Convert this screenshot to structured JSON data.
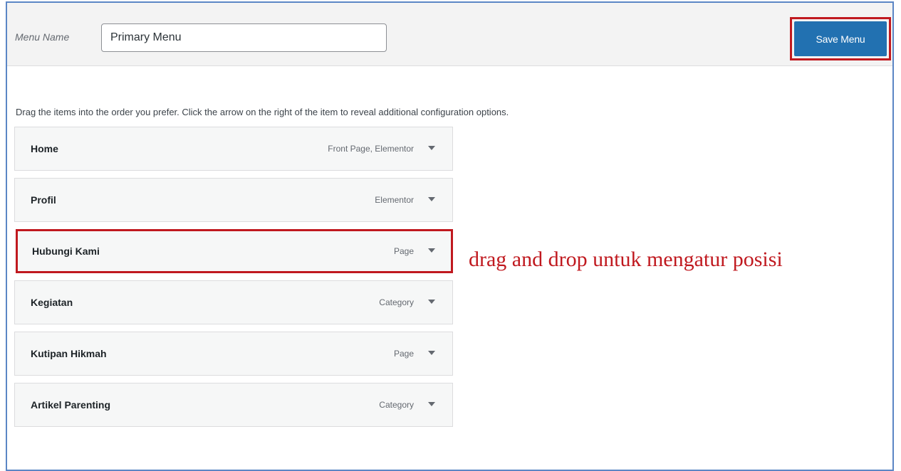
{
  "header": {
    "menu_name_label": "Menu Name",
    "menu_name_value": "Primary Menu",
    "save_label": "Save Menu"
  },
  "instructions": "Drag the items into the order you prefer. Click the arrow on the right of the item to reveal additional configuration options.",
  "menu_items": [
    {
      "title": "Home",
      "type": "Front Page, Elementor"
    },
    {
      "title": "Profil",
      "type": "Elementor"
    },
    {
      "title": "Hubungi Kami",
      "type": "Page"
    },
    {
      "title": "Kegiatan",
      "type": "Category"
    },
    {
      "title": "Kutipan Hikmah",
      "type": "Page"
    },
    {
      "title": "Artikel Parenting",
      "type": "Category"
    }
  ],
  "annotation": "drag and drop untuk mengatur posisi",
  "icons": {
    "toggle": "arrow-down-icon"
  },
  "colors": {
    "accent": "#2271b1",
    "highlight": "#c0191f",
    "frame": "#5b86c5"
  }
}
